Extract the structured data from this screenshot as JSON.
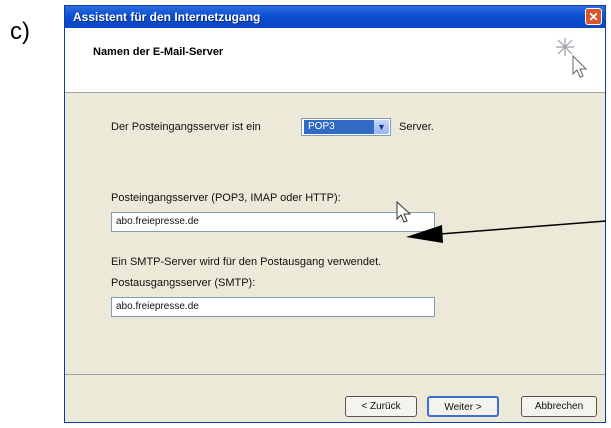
{
  "figure_label": "c)",
  "window": {
    "title": "Assistent für den Internetzugang",
    "close_label": "✕"
  },
  "header": {
    "title": "Namen der E-Mail-Server"
  },
  "incoming_type": {
    "prefix": "Der Posteingangsserver ist ein",
    "selected": "POP3",
    "suffix": "Server."
  },
  "incoming": {
    "label": "Posteingangsserver (POP3, IMAP oder HTTP):",
    "value": "abo.freiepresse.de"
  },
  "smtp_note": "Ein SMTP-Server wird für den Postausgang verwendet.",
  "outgoing": {
    "label": "Postausgangsserver (SMTP):",
    "value": "abo.freiepresse.de"
  },
  "buttons": {
    "back": "< Zurück",
    "next": "Weiter >",
    "cancel": "Abbrechen"
  },
  "icons": {
    "close": "close-icon",
    "wizard": "sparkle-cursor-icon",
    "dropdown": "chevron-down-icon",
    "pointer": "mouse-pointer-icon"
  }
}
